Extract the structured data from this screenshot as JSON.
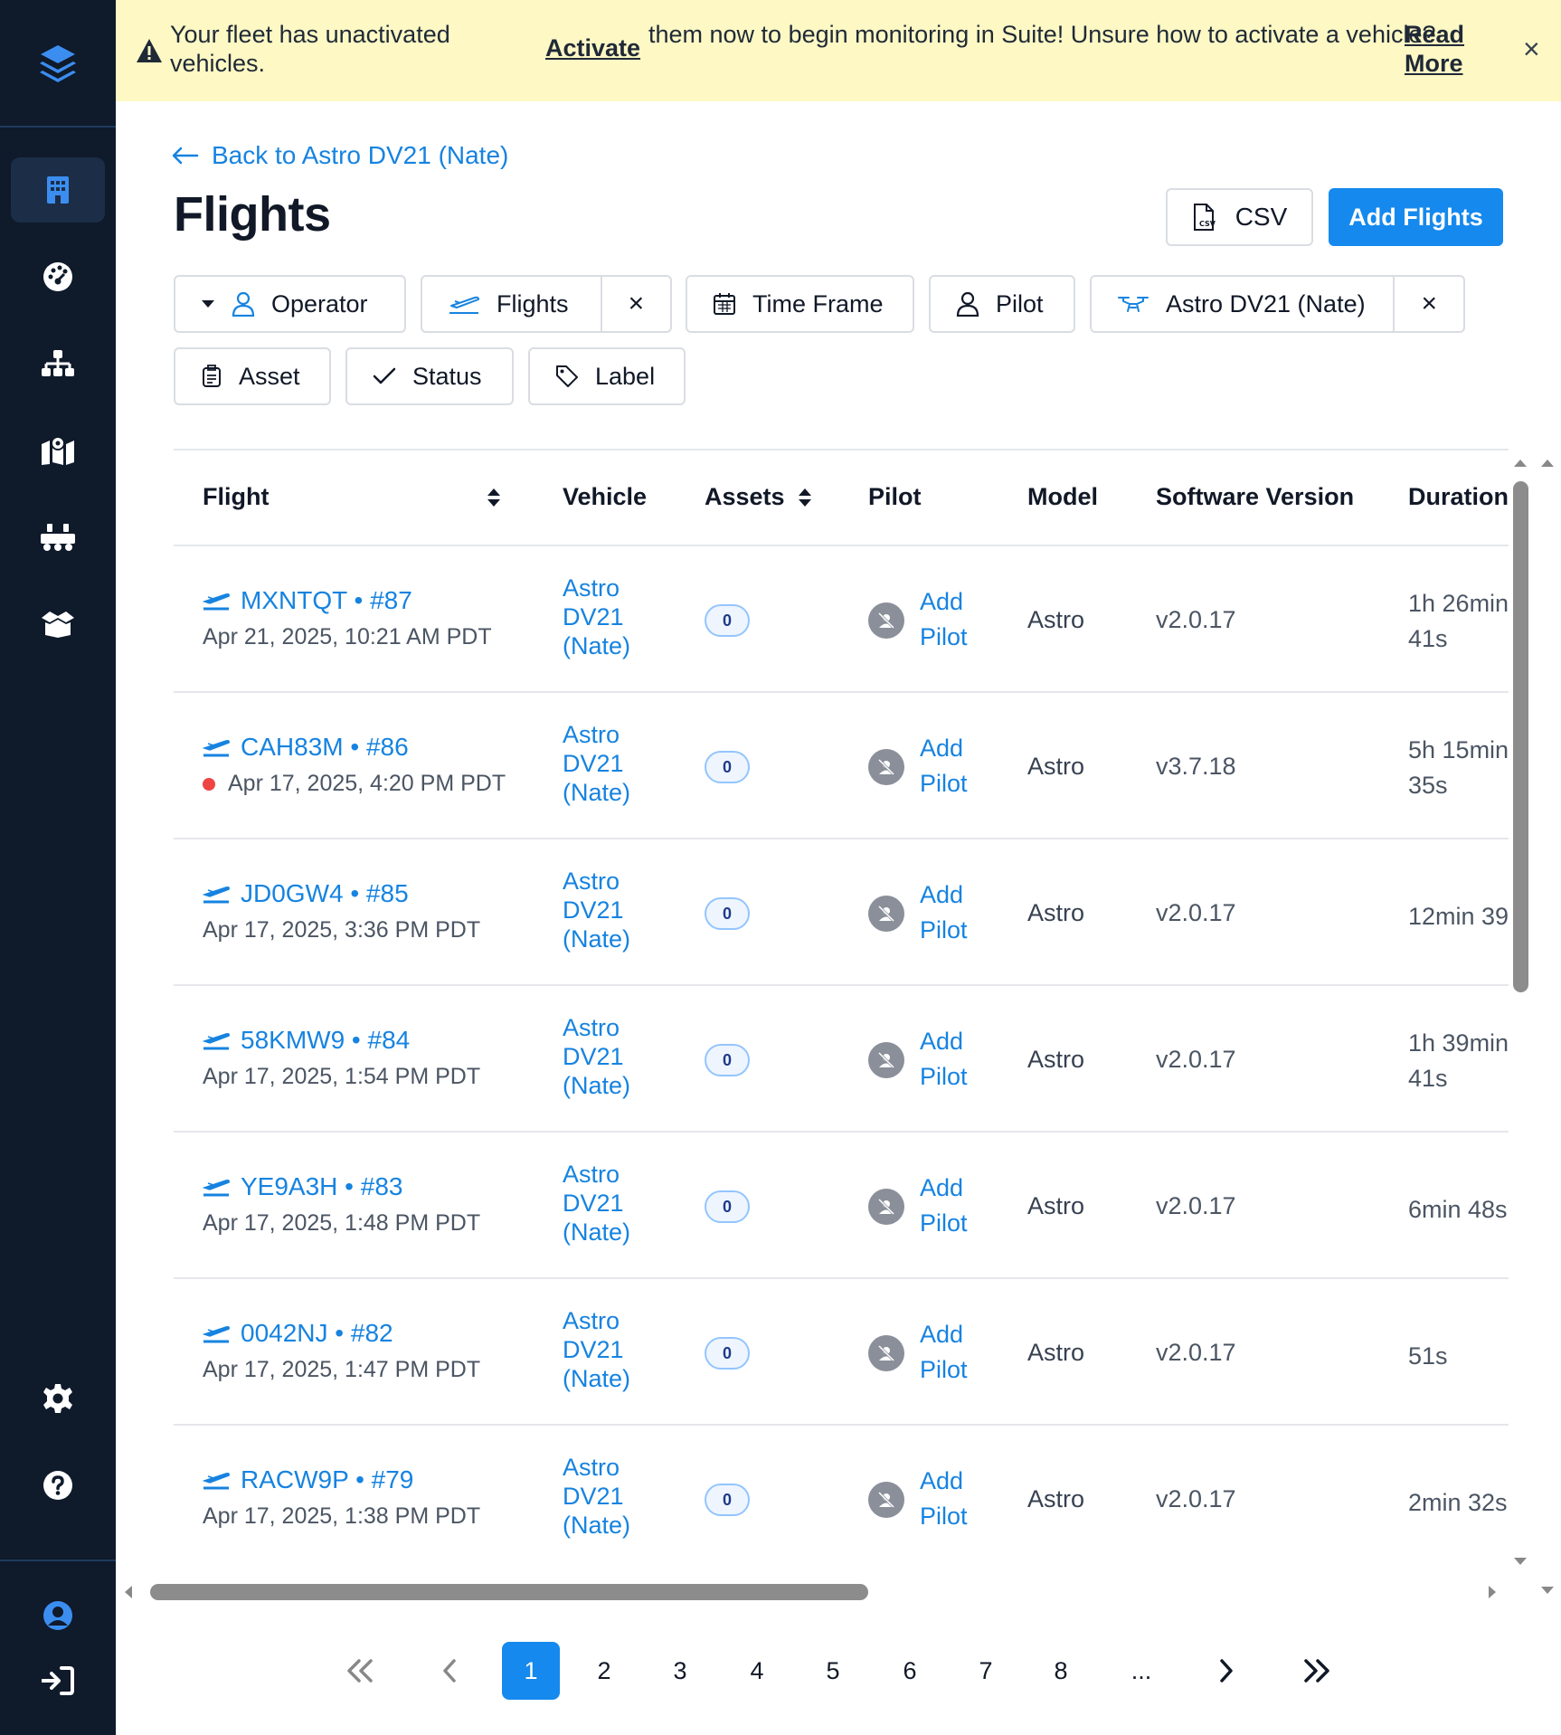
{
  "banner": {
    "text_before": "Your fleet has unactivated vehicles.",
    "link": "Activate",
    "text_after": "them now to begin monitoring in Suite! Unsure how to activate a vehicle?",
    "read_more": "Read More",
    "close": "×"
  },
  "header": {
    "back": "Back to Astro DV21 (Nate)",
    "title": "Flights",
    "csv": "CSV",
    "add": "Add Flights"
  },
  "filters": {
    "operator": "Operator",
    "flights": "Flights",
    "time_frame": "Time Frame",
    "pilot": "Pilot",
    "vehicle": "Astro DV21 (Nate)",
    "asset": "Asset",
    "status": "Status",
    "label": "Label",
    "remove": "×"
  },
  "table": {
    "columns": {
      "flight": "Flight",
      "vehicle": "Vehicle",
      "assets": "Assets",
      "pilot": "Pilot",
      "model": "Model",
      "software": "Software Version",
      "duration": "Duration"
    },
    "rows": [
      {
        "id": "MXNTQT • #87",
        "date": "Apr 21, 2025, 10:21 AM PDT",
        "vehicle": "Astro DV21 (Nate)",
        "assets": "0",
        "pilot": "Add Pilot",
        "model": "Astro",
        "software": "v2.0.17",
        "duration": "1h 26min 41s"
      },
      {
        "id": "CAH83M • #86",
        "date": "Apr 17, 2025, 4:20 PM PDT",
        "vehicle": "Astro DV21 (Nate)",
        "assets": "0",
        "pilot": "Add Pilot",
        "model": "Astro",
        "software": "v3.7.18",
        "duration": "5h 15min 35s"
      },
      {
        "id": "JD0GW4 • #85",
        "date": "Apr 17, 2025, 3:36 PM PDT",
        "vehicle": "Astro DV21 (Nate)",
        "assets": "0",
        "pilot": "Add Pilot",
        "model": "Astro",
        "software": "v2.0.17",
        "duration": "12min 39"
      },
      {
        "id": "58KMW9 • #84",
        "date": "Apr 17, 2025, 1:54 PM PDT",
        "vehicle": "Astro DV21 (Nate)",
        "assets": "0",
        "pilot": "Add Pilot",
        "model": "Astro",
        "software": "v2.0.17",
        "duration": "1h 39min 41s"
      },
      {
        "id": "YE9A3H • #83",
        "date": "Apr 17, 2025, 1:48 PM PDT",
        "vehicle": "Astro DV21 (Nate)",
        "assets": "0",
        "pilot": "Add Pilot",
        "model": "Astro",
        "software": "v2.0.17",
        "duration": "6min 48s"
      },
      {
        "id": "0042NJ • #82",
        "date": "Apr 17, 2025, 1:47 PM PDT",
        "vehicle": "Astro DV21 (Nate)",
        "assets": "0",
        "pilot": "Add Pilot",
        "model": "Astro",
        "software": "v2.0.17",
        "duration": "51s"
      },
      {
        "id": "RACW9P • #79",
        "date": "Apr 17, 2025, 1:38 PM PDT",
        "vehicle": "Astro DV21 (Nate)",
        "assets": "0",
        "pilot": "Add Pilot",
        "model": "Astro",
        "software": "v2.0.17",
        "duration": "2min 32s"
      }
    ]
  },
  "pagination": {
    "pages": [
      "1",
      "2",
      "3",
      "4",
      "5",
      "6",
      "7",
      "8"
    ],
    "ellipsis": "...",
    "current": "1"
  },
  "colors": {
    "accent": "#1589ee",
    "link": "#1683e0",
    "sidebar": "#0f1a2b",
    "banner": "#fdf8c4",
    "error_dot": "#ef4444"
  }
}
